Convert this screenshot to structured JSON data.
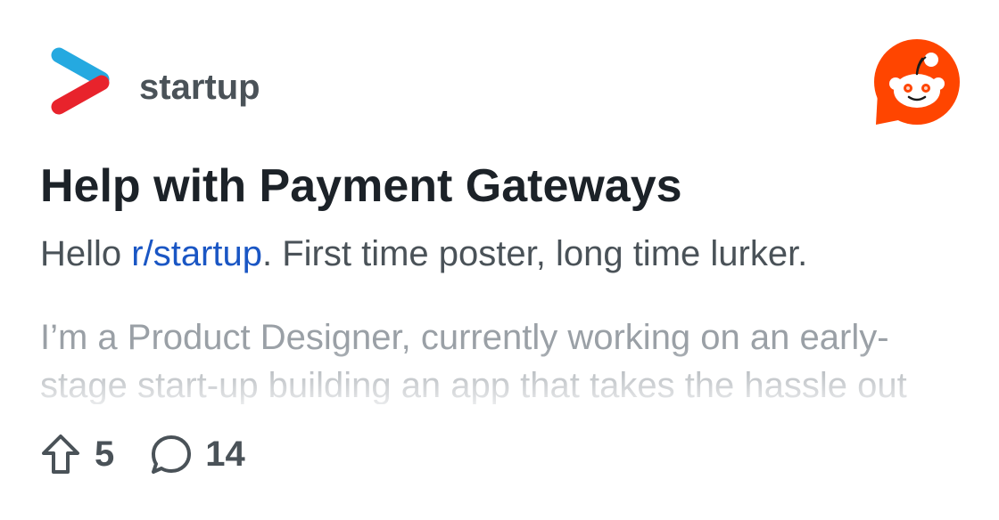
{
  "community": {
    "name": "startup",
    "logo_icon": "startup-chevron-logo-icon"
  },
  "brand": {
    "logo_icon": "reddit-snoo-icon",
    "color": "#ff4500"
  },
  "post": {
    "title": "Help with Payment Gateways",
    "intro_prefix": "Hello ",
    "intro_link": "r/startup",
    "intro_suffix": ". First time poster, long time lurker.",
    "body_lines": [
      "I’m a Product Designer, currently working on an early-",
      "stage start-up building an app that takes the hassle out"
    ]
  },
  "stats": {
    "upvotes": "5",
    "upvote_icon": "upvote-arrow-icon",
    "comments": "14",
    "comment_icon": "comment-bubble-icon"
  }
}
